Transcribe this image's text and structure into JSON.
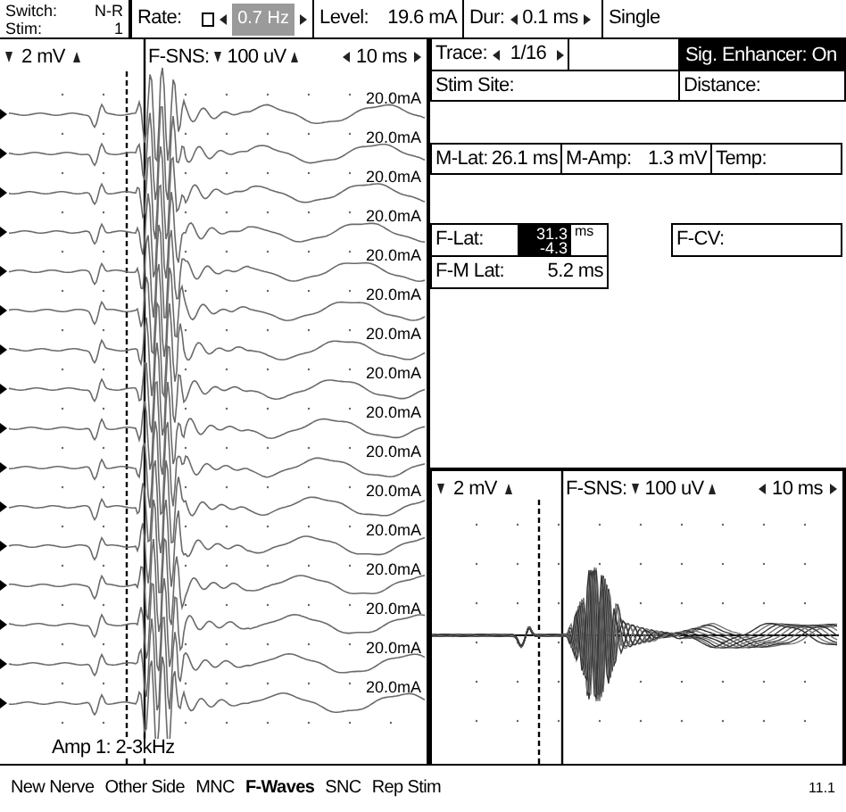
{
  "switch_stim": {
    "switch_label": "Switch:",
    "switch_value": "N-R",
    "stim_label": "Stim:",
    "stim_value": "1"
  },
  "rate": {
    "label": "Rate:",
    "checked": false,
    "value": "0.7 Hz"
  },
  "level": {
    "label": "Level:",
    "value": "19.6 mA"
  },
  "duration": {
    "label": "Dur:",
    "value": "0.1 ms"
  },
  "mode": "Single",
  "trace": {
    "label": "Trace:",
    "value": "1/16"
  },
  "sig_enhancer": {
    "text": "Sig. Enhancer: On",
    "on": true
  },
  "stim_site": {
    "label": "Stim Site:"
  },
  "distance": {
    "label": "Distance:"
  },
  "m_lat": {
    "label": "M-Lat:",
    "value": "26.1 ms"
  },
  "m_amp": {
    "label": "M-Amp:",
    "value": "1.3 mV"
  },
  "temp": {
    "label": "Temp:"
  },
  "f_lat": {
    "label": "F-Lat:",
    "value": "31.3",
    "value_2": "-4.3",
    "unit": "ms"
  },
  "f_cv": {
    "label": "F-CV:"
  },
  "f_m_lat": {
    "label": "F-M Lat:",
    "value": "5.2 ms"
  },
  "main_plot": {
    "gain": "2 mV",
    "sensitivity_label": "F-SNS:",
    "sensitivity": "100 uV",
    "sweep": "10 ms",
    "amplifier": "Amp 1: 2-3kHz",
    "stim_levels": [
      "20.0mA",
      "20.0mA",
      "20.0mA",
      "20.0mA",
      "20.0mA",
      "20.0mA",
      "20.0mA",
      "20.0mA",
      "20.0mA",
      "20.0mA",
      "20.0mA",
      "20.0mA",
      "20.0mA",
      "20.0mA",
      "20.0mA",
      "20.0mA"
    ]
  },
  "overlay_plot": {
    "gain": "2 mV",
    "sensitivity_label": "F-SNS:",
    "sensitivity": "100 uV",
    "sweep": "10 ms"
  },
  "menu": [
    {
      "label": "New Nerve",
      "selected": false
    },
    {
      "label": "Other Side",
      "selected": false
    },
    {
      "label": "MNC",
      "selected": false
    },
    {
      "label": "F-Waves",
      "selected": true
    },
    {
      "label": "SNC",
      "selected": false
    },
    {
      "label": "Rep Stim",
      "selected": false
    }
  ],
  "version": "11.1"
}
